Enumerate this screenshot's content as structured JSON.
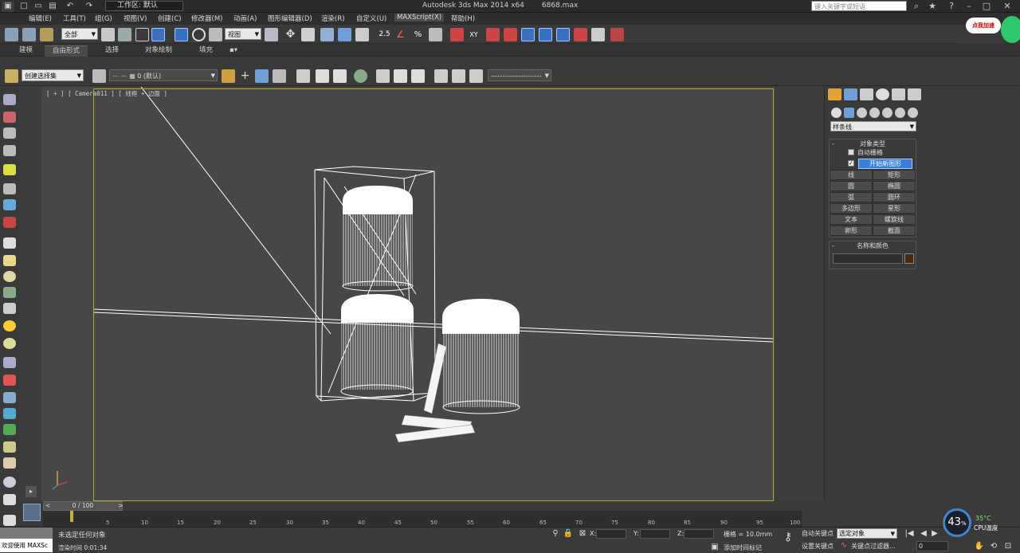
{
  "titlebar": {
    "workspace": "工作区: 默认",
    "app_name": "Autodesk 3ds Max  2014 x64",
    "file_name": "6868.max",
    "search_placeholder": "键入关键字或短语"
  },
  "menubar": {
    "items": [
      "编辑(E)",
      "工具(T)",
      "组(G)",
      "视图(V)",
      "创建(C)",
      "修改器(M)",
      "动画(A)",
      "图形编辑器(D)",
      "渲染(R)",
      "自定义(U)",
      "MAXScript(X)",
      "帮助(H)"
    ]
  },
  "main_toolbar": {
    "selection_filter": "全部",
    "ref_coord": "视图",
    "snap_label": "2.5",
    "xy_label": "XY"
  },
  "logo_badge": "点我加速",
  "ribbon": {
    "tabs": [
      "建模",
      "自由形式",
      "选择",
      "对象绘制",
      "填充"
    ]
  },
  "sec_toolbar": {
    "named_selection": "创建选择集",
    "layer": "0 (默认)",
    "line_style": "----------------------"
  },
  "viewport": {
    "label": "[ + ] [ Camera011 ] [ 线框 + 边面 ]"
  },
  "command_panel": {
    "category": "样条线",
    "object_type_title": "对象类型",
    "auto_grid": "自动栅格",
    "start_new_shape": "开始新图形",
    "buttons": [
      "线",
      "矩形",
      "圆",
      "椭圆",
      "弧",
      "圆环",
      "多边形",
      "星形",
      "文本",
      "螺旋线",
      "卵形",
      "截面"
    ],
    "name_color_title": "名称和颜色",
    "object_color": "#4a2a14"
  },
  "timeline": {
    "frame_display": "0 / 100",
    "ticks": [
      "5",
      "10",
      "15",
      "20",
      "25",
      "30",
      "35",
      "40",
      "45",
      "50",
      "55",
      "60",
      "65",
      "70",
      "75",
      "80",
      "85",
      "90",
      "95",
      "100"
    ]
  },
  "status_bar": {
    "maxscript": "欢迎使用 MAXSc",
    "prompt": "未选定任何对象",
    "render_time": "渲染时间  0:01:34",
    "x_label": "X:",
    "y_label": "Y:",
    "z_label": "Z:",
    "grid": "栅格 = 10.0mm",
    "add_time_tag": "添加时间标记",
    "auto_key": "自动关键点",
    "selected_option": "选定对象",
    "set_key": "设置关键点",
    "key_filters": "关键点过滤器...",
    "frame_value": "0"
  },
  "cpu_widget": {
    "usage": "43",
    "usage_unit": "%",
    "temperature": "35°C",
    "label": "CPU温度"
  }
}
